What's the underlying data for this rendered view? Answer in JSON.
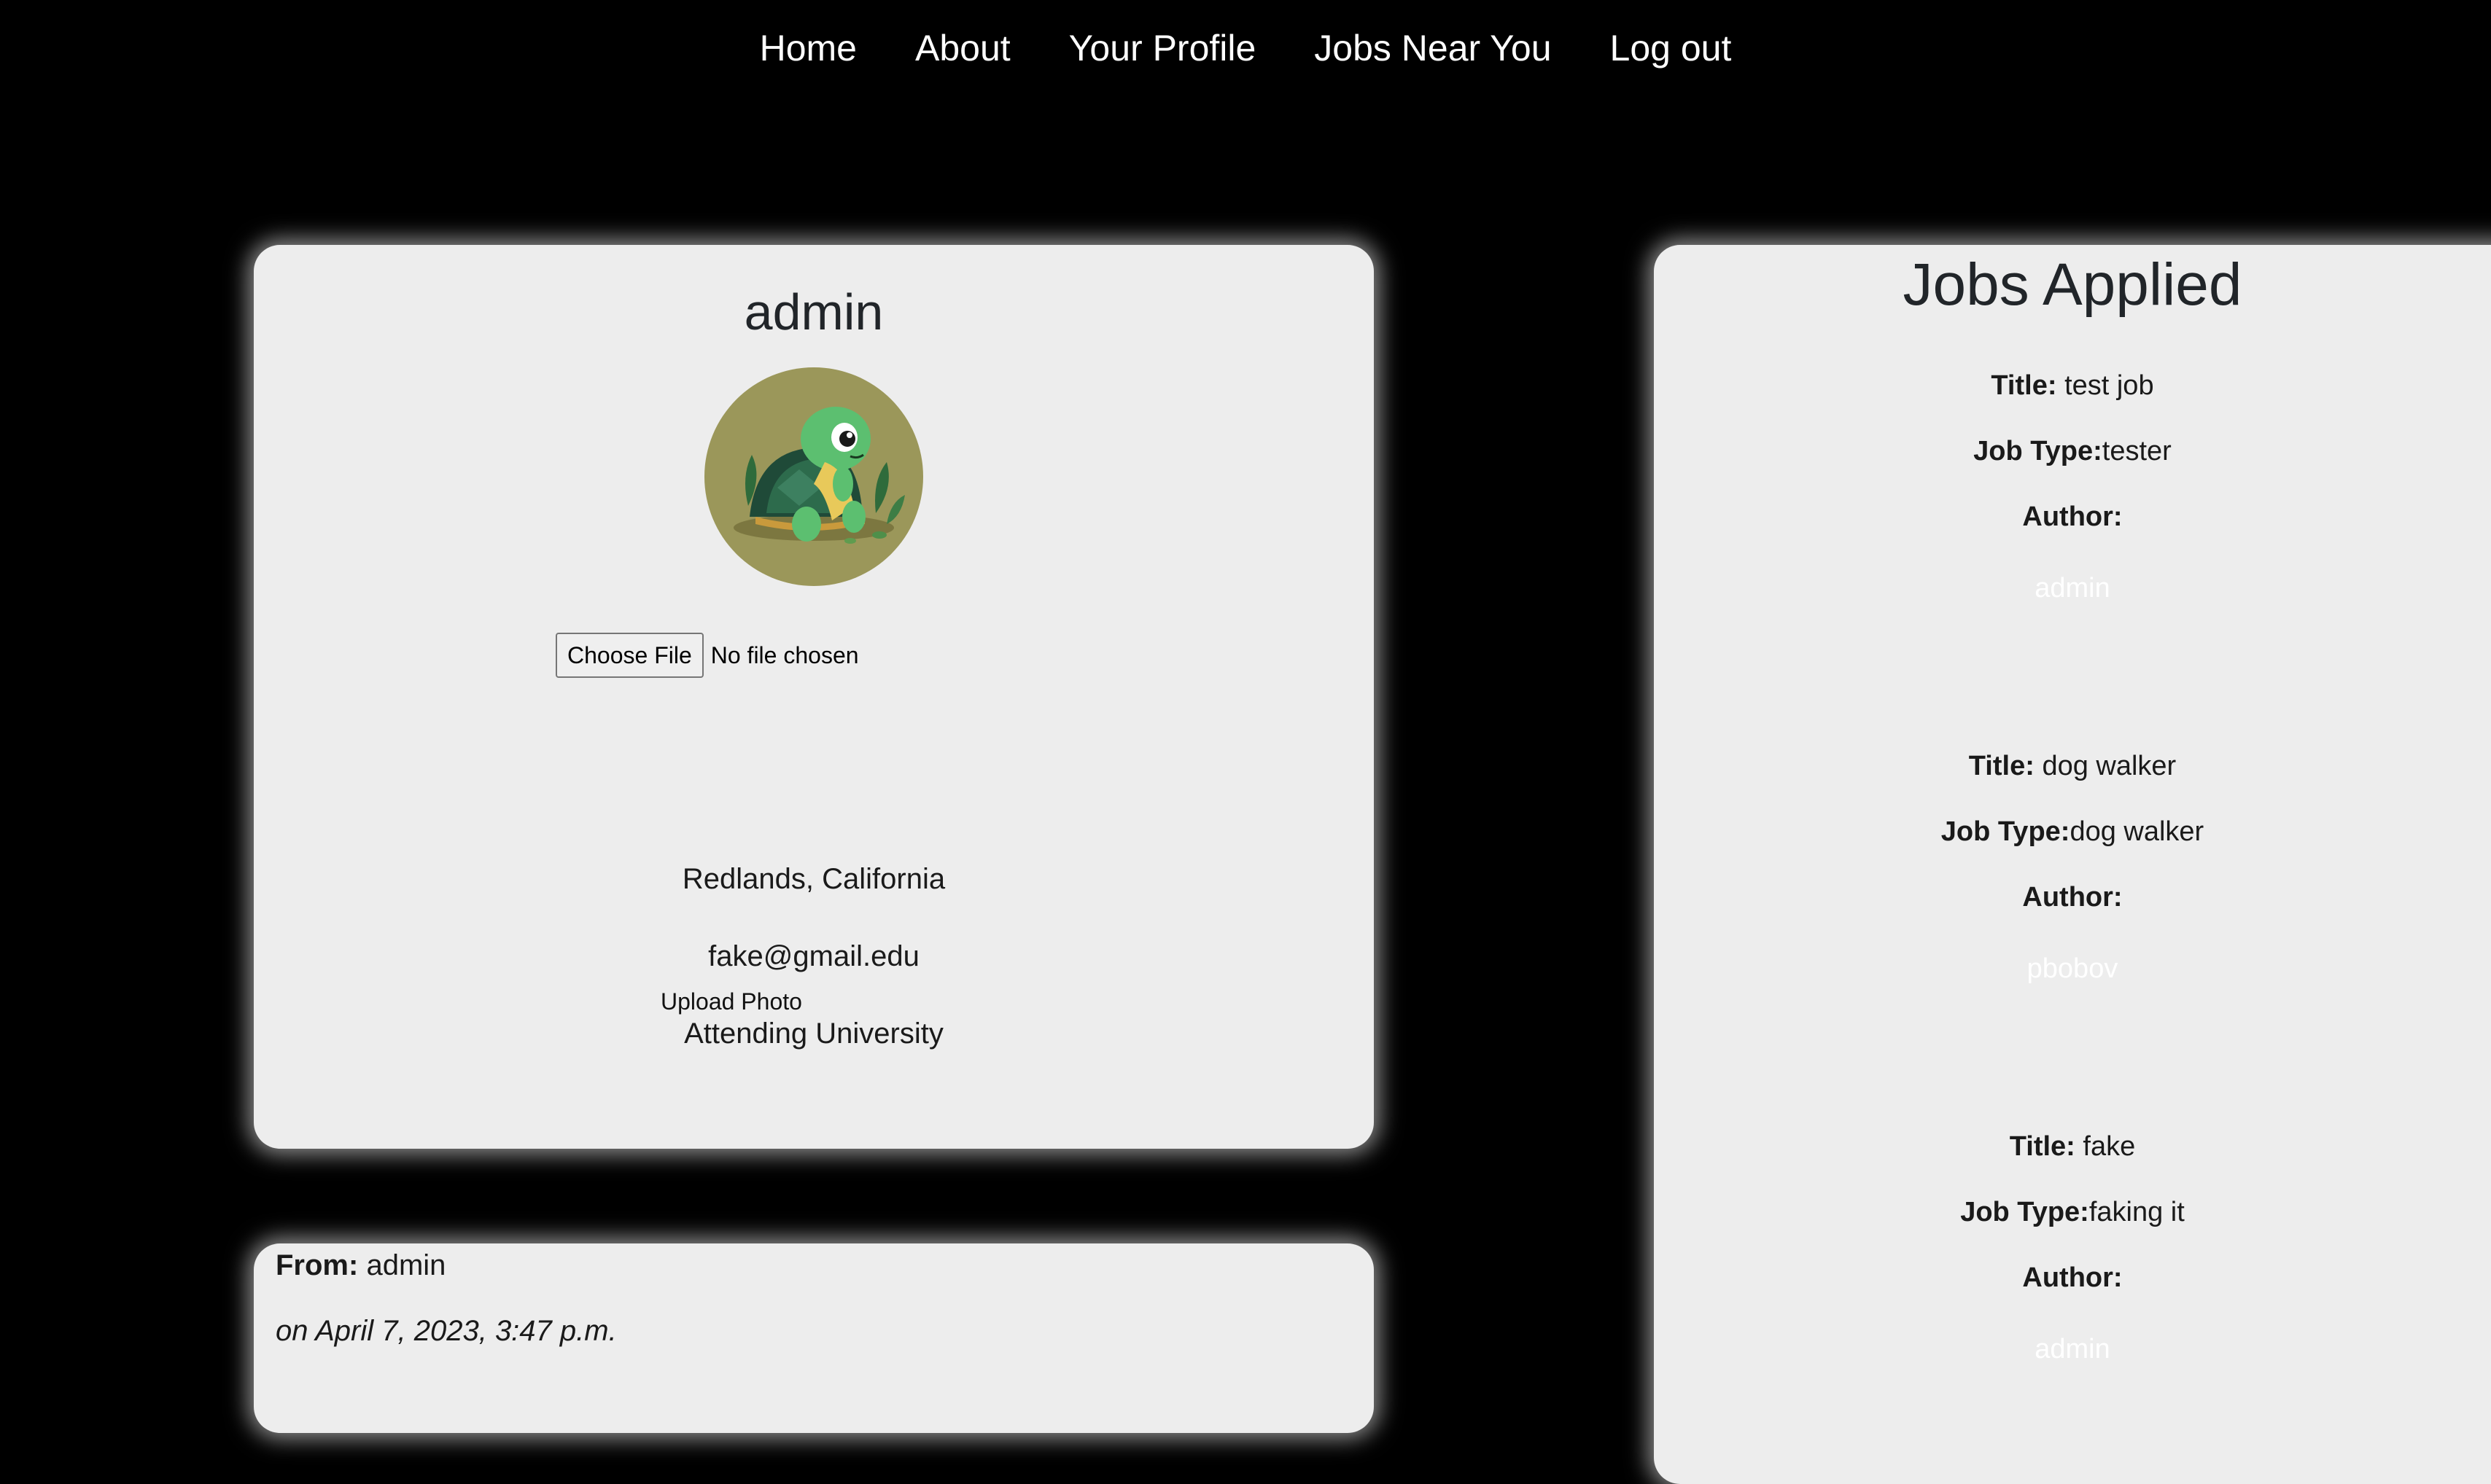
{
  "nav": {
    "items": [
      {
        "label": "Home"
      },
      {
        "label": "About"
      },
      {
        "label": "Your Profile"
      },
      {
        "label": "Jobs Near You"
      },
      {
        "label": "Log out"
      }
    ]
  },
  "profile": {
    "name": "admin",
    "avatar_icon": "turtle-avatar-icon",
    "file_input": {
      "button_label": "Choose File",
      "status": "No file chosen"
    },
    "upload_label": "Upload Photo",
    "location": "Redlands, California",
    "email": "fake@gmail.edu",
    "education": "Attending University"
  },
  "message": {
    "from_label": "From:",
    "from_value": "admin",
    "date": "on April 7, 2023, 3:47 p.m."
  },
  "jobs": {
    "heading": "Jobs Applied",
    "title_label": "Title:",
    "type_label": "Job Type:",
    "author_label": "Author:",
    "items": [
      {
        "title": "test job",
        "type": "tester",
        "author": "admin"
      },
      {
        "title": "dog walker",
        "type": "dog walker",
        "author": "pbobov"
      },
      {
        "title": "fake",
        "type": "faking it",
        "author": "admin"
      }
    ]
  },
  "colors": {
    "background": "#000000",
    "card": "#ededed",
    "avatar_bg": "#9b975a",
    "link": "#ffffff"
  }
}
